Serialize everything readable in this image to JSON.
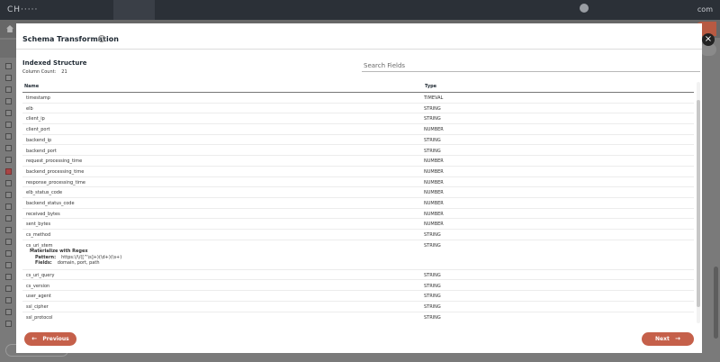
{
  "modal": {
    "title": "Schema Transformation",
    "close_icon": "×",
    "info_icon": "i",
    "section_title": "Indexed Structure",
    "column_count_label": "Column Count:",
    "column_count_value": "21",
    "search_placeholder": "Search Fields",
    "table": {
      "headers": {
        "name": "Name",
        "type": "Type"
      },
      "rows": [
        {
          "name": "timestamp",
          "type": "TIMEVAL"
        },
        {
          "name": "elb",
          "type": "STRING"
        },
        {
          "name": "client_ip",
          "type": "STRING"
        },
        {
          "name": "client_port",
          "type": "NUMBER"
        },
        {
          "name": "backend_ip",
          "type": "STRING"
        },
        {
          "name": "backend_port",
          "type": "STRING"
        },
        {
          "name": "request_processing_time",
          "type": "NUMBER"
        },
        {
          "name": "backend_processing_time",
          "type": "NUMBER"
        },
        {
          "name": "response_processing_time",
          "type": "NUMBER"
        },
        {
          "name": "elb_status_code",
          "type": "NUMBER"
        },
        {
          "name": "backend_status_code",
          "type": "NUMBER"
        },
        {
          "name": "received_bytes",
          "type": "NUMBER"
        },
        {
          "name": "sent_bytes",
          "type": "NUMBER"
        },
        {
          "name": "cs_method",
          "type": "STRING"
        },
        {
          "name": "cs_uri_stem",
          "type": "STRING",
          "regex": {
            "heading": "Materialize with Regex",
            "pattern_label": "Pattern:",
            "pattern": "https:\\/\\/([^\\s]+)(\\d+)(\\s+)",
            "fields_label": "Fields:",
            "fields": "domain, port, path"
          }
        },
        {
          "name": "cs_uri_query",
          "type": "STRING"
        },
        {
          "name": "cs_version",
          "type": "STRING"
        },
        {
          "name": "user_agent",
          "type": "STRING"
        },
        {
          "name": "ssl_cipher",
          "type": "STRING"
        },
        {
          "name": "ssl_protocol",
          "type": "STRING"
        }
      ]
    },
    "previous_label": "Previous",
    "next_label": "Next",
    "arrow_left": "←",
    "arrow_right": "→"
  }
}
